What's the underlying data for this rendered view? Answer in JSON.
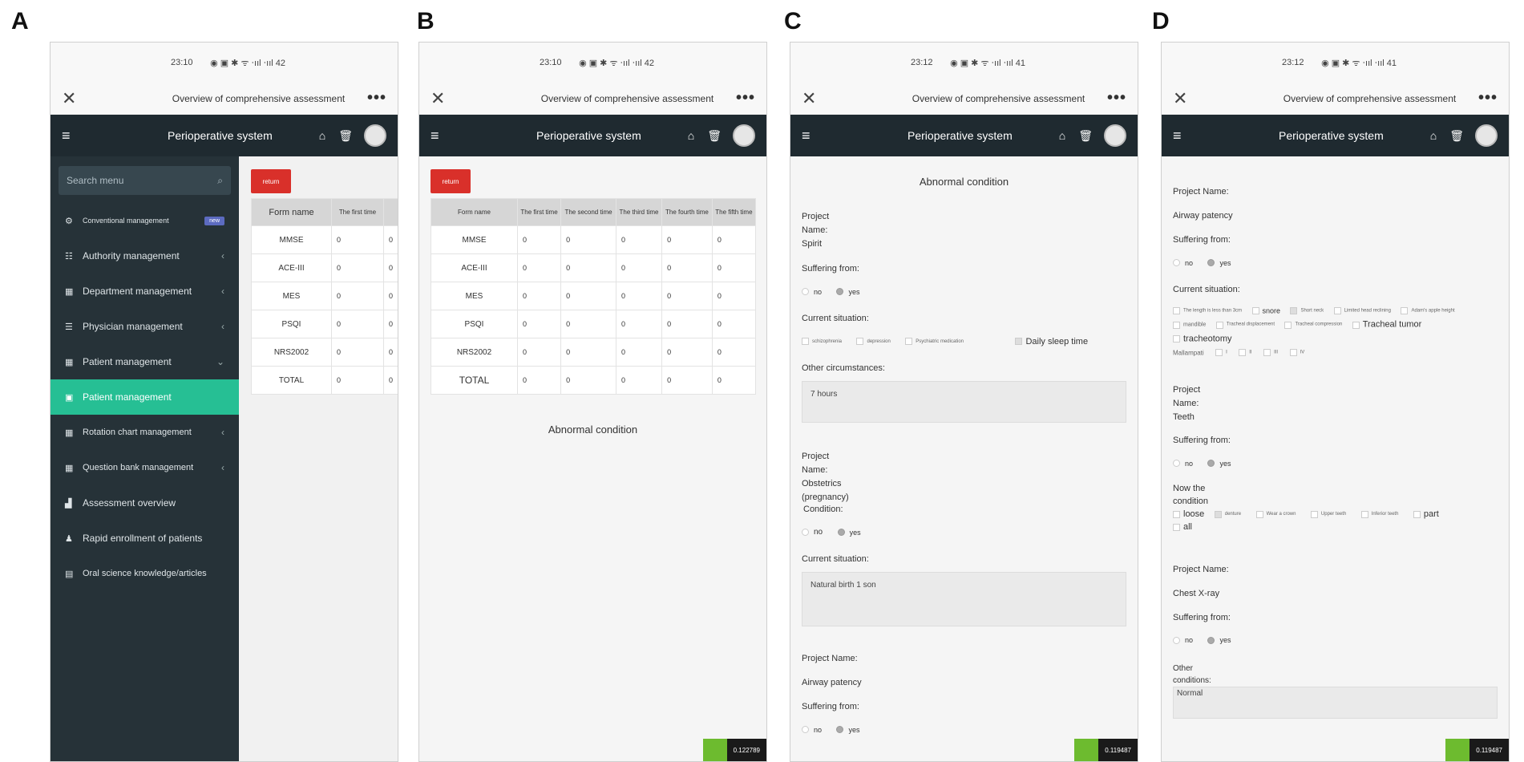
{
  "panels": {
    "a": {
      "letter": "A",
      "time": "23:10"
    },
    "b": {
      "letter": "B",
      "time": "23:10"
    },
    "c": {
      "letter": "C",
      "time": "23:12"
    },
    "d": {
      "letter": "D",
      "time": "23:12"
    }
  },
  "status": {
    "icons_a": "◉ ▣ ✱ ᯤ ‧ııl ‧ııl 42",
    "icons_b": "◉ ▣ ✱ ᯤ ‧ııl ‧ııl 42",
    "icons_c": "◉ ▣ ✱ ᯤ ‧ııl ‧ııl 41",
    "icons_d": "◉ ▣ ✱ ᯤ ‧ııl ‧ııl 41"
  },
  "titlebar": {
    "close": "✕",
    "title": "Overview of comprehensive assessment",
    "more": "•••"
  },
  "appbar": {
    "menu": "≡",
    "title": "Perioperative system",
    "home": "⌂",
    "trash": "🗑"
  },
  "sidebar": {
    "search_placeholder": "Search menu",
    "search_icon": "⌕",
    "items": [
      {
        "label": "Conventional management",
        "icon": "⚙",
        "badge": "new"
      },
      {
        "label": "Authority management",
        "icon": "☷",
        "arrow": "‹"
      },
      {
        "label": "Department management",
        "icon": "▦",
        "arrow": "‹"
      },
      {
        "label": "Physician management",
        "icon": "☰",
        "arrow": "‹"
      },
      {
        "label": "Patient management",
        "icon": "▦",
        "arrow": "⌄"
      },
      {
        "label": "Patient management",
        "icon": "▣"
      },
      {
        "label": "Rotation chart management",
        "icon": "▦",
        "arrow": "‹"
      },
      {
        "label": "Question bank management",
        "icon": "▦",
        "arrow": "‹"
      },
      {
        "label": "Assessment overview",
        "icon": "▟"
      },
      {
        "label": "Rapid enrollment of patients",
        "icon": "♟"
      },
      {
        "label": "Oral science knowledge/articles",
        "icon": "▤"
      }
    ]
  },
  "return_label": "return",
  "table": {
    "headers": [
      "Form name",
      "The first time",
      "The second time",
      "The third time",
      "The fourth time",
      "The fifth time"
    ],
    "rows": [
      {
        "name": "MMSE",
        "values": [
          "0",
          "0",
          "0",
          "0",
          "0"
        ]
      },
      {
        "name": "ACE-III",
        "values": [
          "0",
          "0",
          "0",
          "0",
          "0"
        ]
      },
      {
        "name": "MES",
        "values": [
          "0",
          "0",
          "0",
          "0",
          "0"
        ]
      },
      {
        "name": "PSQI",
        "values": [
          "0",
          "0",
          "0",
          "0",
          "0"
        ]
      },
      {
        "name": "NRS2002",
        "values": [
          "0",
          "0",
          "0",
          "0",
          "0"
        ]
      },
      {
        "name": "TOTAL",
        "values": [
          "0",
          "0",
          "0",
          "0",
          "0"
        ]
      }
    ]
  },
  "abnormal_condition": "Abnormal condition",
  "panel_c": {
    "p1_name": "Project\nName:\nSpirit",
    "suffering": "Suffering from:",
    "no": "no",
    "yes": "yes",
    "current_situation": "Current situation:",
    "opt1": "schizophrenia",
    "opt2": "depression",
    "opt3": "Psychiatric medication",
    "opt4": "Daily sleep time",
    "other": "Other circumstances:",
    "other_value": "7 hours",
    "p2_name": "Project\nName:\nObstetrics\n(pregnancy)",
    "condition": "Condition:",
    "current_situation2": "Current situation:",
    "current_value": "Natural birth 1 son",
    "p3_label": "Project Name:",
    "p3_value": "Airway patency",
    "suffering2": "Suffering from:"
  },
  "panel_d": {
    "p1_label": "Project Name:",
    "p1_value": "Airway patency",
    "suffering": "Suffering from:",
    "no": "no",
    "yes": "yes",
    "current_situation": "Current situation:",
    "opts": [
      "The length is less than 3cm",
      "snore",
      "Short neck",
      "Limited head reclining",
      "Adam's apple height",
      "mandible",
      "Tracheal displacement",
      "Tracheal compression",
      "Tracheal tumor",
      "tracheotomy"
    ],
    "mallampati": "Mallampati",
    "mall_opts": [
      "I",
      "II",
      "III",
      "IV"
    ],
    "p2_name": "Project\nName:\nTeeth",
    "suffering2": "Suffering from:",
    "now_condition": "Now the\ncondition",
    "teeth_opts": [
      "loose",
      "denture",
      "Wear a crown",
      "Upper teeth",
      "Inferior teeth",
      "part",
      "all"
    ],
    "p3_label": "Project Name:",
    "p3_value": "Chest X-ray",
    "suffering3": "Suffering from:",
    "other_conditions": "Other\nconditions:",
    "other_value": "Normal"
  },
  "counters": {
    "b": "0.122789",
    "c": "0.119487",
    "d": "0.119487"
  }
}
